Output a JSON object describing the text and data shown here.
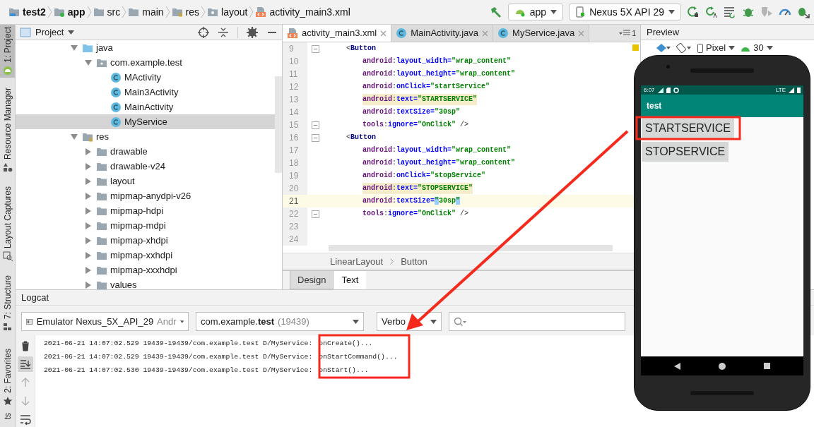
{
  "breadcrumbs": [
    {
      "label": "test2",
      "kind": "project",
      "bold": true
    },
    {
      "label": "app",
      "kind": "module",
      "bold": true
    },
    {
      "label": "src",
      "kind": "folder",
      "bold": false
    },
    {
      "label": "main",
      "kind": "folder",
      "bold": false
    },
    {
      "label": "res",
      "kind": "res",
      "bold": false
    },
    {
      "label": "layout",
      "kind": "layout",
      "bold": false
    },
    {
      "label": "activity_main3.xml",
      "kind": "xml",
      "bold": false
    }
  ],
  "toolbar": {
    "run_config": "app",
    "device": "Nexus 5X API 29",
    "actions": [
      {
        "kind": "rerun",
        "disabled": false
      },
      {
        "kind": "apply-changes",
        "disabled": false
      },
      {
        "kind": "apply-code",
        "disabled": false
      },
      {
        "kind": "debug",
        "disabled": false
      },
      {
        "kind": "coverage",
        "disabled": true
      },
      {
        "kind": "profile",
        "disabled": false
      },
      {
        "kind": "attach",
        "disabled": false
      }
    ]
  },
  "side_tools": [
    {
      "label": "1: Project",
      "kind": "project",
      "selected": true
    },
    {
      "label": "Resource Manager",
      "kind": "resources",
      "selected": false
    },
    {
      "label": "Layout Captures",
      "kind": "captures",
      "selected": false
    },
    {
      "label": "7: Structure",
      "kind": "structure",
      "selected": false
    },
    {
      "label": "2: Favorites",
      "kind": "favorites",
      "selected": false
    },
    {
      "label": "ts",
      "kind": "variants",
      "selected": false
    }
  ],
  "project": {
    "title": "Project",
    "tree": [
      {
        "label": "java",
        "kind": "source",
        "expanded": true,
        "selected": false,
        "children": [
          {
            "label": "com.example.test",
            "kind": "package",
            "expanded": true,
            "selected": false,
            "children": [
              {
                "label": "MActivity",
                "kind": "class",
                "selected": false
              },
              {
                "label": "Main3Activity",
                "kind": "class",
                "selected": false
              },
              {
                "label": "MainActivity",
                "kind": "class",
                "selected": false
              },
              {
                "label": "MyService",
                "kind": "class",
                "selected": true
              }
            ]
          }
        ]
      },
      {
        "label": "res",
        "kind": "res",
        "expanded": true,
        "selected": false,
        "children": [
          {
            "label": "drawable",
            "kind": "folder",
            "expanded": false,
            "selected": false
          },
          {
            "label": "drawable-v24",
            "kind": "folder",
            "expanded": false,
            "selected": false
          },
          {
            "label": "layout",
            "kind": "folder",
            "expanded": false,
            "selected": false
          },
          {
            "label": "mipmap-anydpi-v26",
            "kind": "folder",
            "expanded": false,
            "selected": false
          },
          {
            "label": "mipmap-hdpi",
            "kind": "folder",
            "expanded": false,
            "selected": false
          },
          {
            "label": "mipmap-mdpi",
            "kind": "folder",
            "expanded": false,
            "selected": false
          },
          {
            "label": "mipmap-xhdpi",
            "kind": "folder",
            "expanded": false,
            "selected": false
          },
          {
            "label": "mipmap-xxhdpi",
            "kind": "folder",
            "expanded": false,
            "selected": false
          },
          {
            "label": "mipmap-xxxhdpi",
            "kind": "folder",
            "expanded": false,
            "selected": false
          },
          {
            "label": "values",
            "kind": "folder",
            "expanded": false,
            "selected": false
          }
        ]
      }
    ]
  },
  "editor": {
    "tabs": [
      {
        "label": "activity_main3.xml",
        "kind": "xml",
        "selected": true
      },
      {
        "label": "MainActivity.java",
        "kind": "class",
        "selected": false
      },
      {
        "label": "MyService.java",
        "kind": "class",
        "selected": false
      }
    ],
    "overflow_count": "1",
    "lines": [
      {
        "number": "9",
        "kind": "tag",
        "fold": true,
        "highlighted": false,
        "current": false,
        "tokens": [
          {
            "kind": "punct",
            "text": "<"
          },
          {
            "kind": "tag",
            "text": "Button"
          }
        ]
      },
      {
        "number": "10",
        "kind": "attr",
        "fold": false,
        "highlighted": false,
        "current": false,
        "tokens": [
          {
            "kind": "ns",
            "text": "android"
          },
          {
            "kind": "punct",
            "text": ":"
          },
          {
            "kind": "attr",
            "text": "layout_width="
          },
          {
            "kind": "value",
            "text": "\"wrap_content\""
          }
        ]
      },
      {
        "number": "11",
        "kind": "attr",
        "fold": false,
        "highlighted": false,
        "current": false,
        "tokens": [
          {
            "kind": "ns",
            "text": "android"
          },
          {
            "kind": "punct",
            "text": ":"
          },
          {
            "kind": "attr",
            "text": "layout_height="
          },
          {
            "kind": "value",
            "text": "\"wrap_content\""
          }
        ]
      },
      {
        "number": "12",
        "kind": "attr",
        "fold": false,
        "highlighted": false,
        "current": false,
        "tokens": [
          {
            "kind": "ns",
            "text": "android"
          },
          {
            "kind": "punct",
            "text": ":"
          },
          {
            "kind": "attr",
            "text": "onClick="
          },
          {
            "kind": "value",
            "text": "\"startService\""
          }
        ]
      },
      {
        "number": "13",
        "kind": "attr",
        "fold": false,
        "highlighted": true,
        "current": false,
        "tokens": [
          {
            "kind": "ns",
            "text": "android"
          },
          {
            "kind": "punct",
            "text": ":"
          },
          {
            "kind": "attr",
            "text": "text="
          },
          {
            "kind": "value",
            "text": "\"STARTSERVICE\""
          }
        ]
      },
      {
        "number": "14",
        "kind": "attr",
        "fold": false,
        "highlighted": false,
        "current": false,
        "tokens": [
          {
            "kind": "ns",
            "text": "android"
          },
          {
            "kind": "punct",
            "text": ":"
          },
          {
            "kind": "attr",
            "text": "textSize="
          },
          {
            "kind": "value",
            "text": "\"30sp\""
          }
        ]
      },
      {
        "number": "15",
        "kind": "attr",
        "fold": true,
        "highlighted": false,
        "current": false,
        "tokens": [
          {
            "kind": "ns",
            "text": "tools"
          },
          {
            "kind": "punct",
            "text": ":"
          },
          {
            "kind": "attr",
            "text": "ignore="
          },
          {
            "kind": "value",
            "text": "\"OnClick\""
          },
          {
            "kind": "end",
            "text": "/>"
          }
        ]
      },
      {
        "number": "16",
        "kind": "tag",
        "fold": true,
        "highlighted": false,
        "current": false,
        "tokens": [
          {
            "kind": "punct",
            "text": "<"
          },
          {
            "kind": "tag",
            "text": "Button"
          }
        ]
      },
      {
        "number": "17",
        "kind": "attr",
        "fold": false,
        "highlighted": false,
        "current": false,
        "tokens": [
          {
            "kind": "ns",
            "text": "android"
          },
          {
            "kind": "punct",
            "text": ":"
          },
          {
            "kind": "attr",
            "text": "layout_width="
          },
          {
            "kind": "value",
            "text": "\"wrap_content\""
          }
        ]
      },
      {
        "number": "18",
        "kind": "attr",
        "fold": false,
        "highlighted": false,
        "current": false,
        "tokens": [
          {
            "kind": "ns",
            "text": "android"
          },
          {
            "kind": "punct",
            "text": ":"
          },
          {
            "kind": "attr",
            "text": "layout_height="
          },
          {
            "kind": "value",
            "text": "\"wrap_content\""
          }
        ]
      },
      {
        "number": "19",
        "kind": "attr",
        "fold": false,
        "highlighted": false,
        "current": false,
        "tokens": [
          {
            "kind": "ns",
            "text": "android"
          },
          {
            "kind": "punct",
            "text": ":"
          },
          {
            "kind": "attr",
            "text": "onClick="
          },
          {
            "kind": "value",
            "text": "\"stopService\""
          }
        ]
      },
      {
        "number": "20",
        "kind": "attr",
        "fold": false,
        "highlighted": true,
        "current": false,
        "tokens": [
          {
            "kind": "ns",
            "text": "android"
          },
          {
            "kind": "punct",
            "text": ":"
          },
          {
            "kind": "attr",
            "text": "text="
          },
          {
            "kind": "value",
            "text": "\"STOPSERVICE\""
          }
        ]
      },
      {
        "number": "21",
        "kind": "attr",
        "fold": false,
        "highlighted": false,
        "current": true,
        "tokens": [
          {
            "kind": "ns",
            "text": "android"
          },
          {
            "kind": "punct",
            "text": ":"
          },
          {
            "kind": "attr",
            "text": "textSize="
          },
          {
            "kind": "match",
            "text": "\""
          },
          {
            "kind": "value",
            "text": "30sp"
          },
          {
            "kind": "match",
            "text": "\""
          }
        ]
      },
      {
        "number": "22",
        "kind": "attr",
        "fold": true,
        "highlighted": false,
        "current": false,
        "tokens": [
          {
            "kind": "ns",
            "text": "tools"
          },
          {
            "kind": "punct",
            "text": ":"
          },
          {
            "kind": "attr",
            "text": "ignore="
          },
          {
            "kind": "value",
            "text": "\"OnClick\""
          },
          {
            "kind": "end",
            "text": "/>"
          }
        ]
      },
      {
        "number": "23",
        "kind": "blank",
        "fold": false,
        "highlighted": false,
        "current": false
      },
      {
        "number": "24",
        "kind": "blank",
        "fold": false,
        "highlighted": false,
        "current": false
      }
    ],
    "path": [
      "LinearLayout",
      "Button"
    ],
    "mode_tabs": [
      {
        "label": "Design",
        "selected": false
      },
      {
        "label": "Text",
        "selected": true
      }
    ]
  },
  "preview": {
    "title": "Preview",
    "device": "Pixel",
    "api": "30"
  },
  "phone": {
    "time": "6:07",
    "network": "LTE",
    "app_title": "test",
    "buttons": [
      "STARTSERVICE",
      "STOPSERVICE"
    ]
  },
  "logcat": {
    "title": "Logcat",
    "device": "Emulator Nexus_5X_API_29",
    "device_suffix": "Andr",
    "process": "com.example.**test**",
    "pid": "(19439)",
    "level": "Verbo",
    "tools": [
      {
        "kind": "delete",
        "selected": false,
        "disabled": false
      },
      {
        "kind": "scroll-end",
        "selected": true,
        "disabled": false
      },
      {
        "kind": "up",
        "selected": false,
        "disabled": true
      },
      {
        "kind": "down",
        "selected": false,
        "disabled": true
      },
      {
        "kind": "wrap",
        "selected": false,
        "disabled": false
      }
    ],
    "lines": [
      {
        "prefix": "2021-06-21 14:07:02.529 19439-19439/com.example.test D/MyService:",
        "message": "onCreate()..."
      },
      {
        "prefix": "2021-06-21 14:07:02.529 19439-19439/com.example.test D/MyService:",
        "message": "onStartCommand()..."
      },
      {
        "prefix": "2021-06-21 14:07:02.530 19439-19439/com.example.test D/MyService:",
        "message": "onStart()..."
      }
    ]
  }
}
